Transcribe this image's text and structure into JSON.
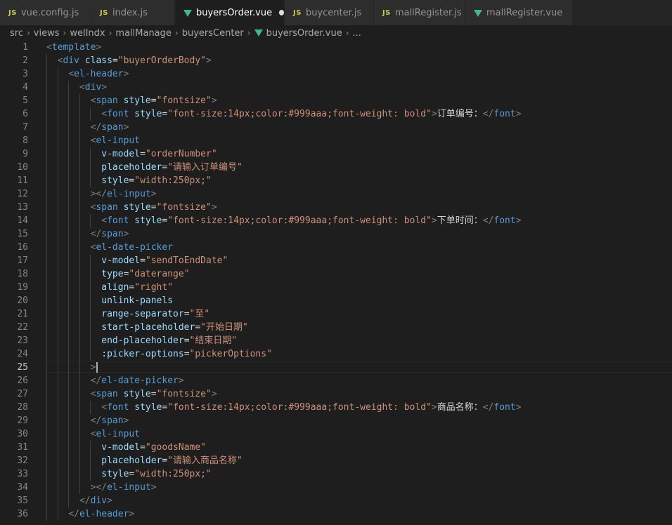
{
  "tabs": [
    {
      "icon": "js",
      "label": "vue.config.js",
      "active": false,
      "dirty": false
    },
    {
      "icon": "js",
      "label": "index.js",
      "active": false,
      "dirty": false
    },
    {
      "icon": "vue",
      "label": "buyersOrder.vue",
      "active": true,
      "dirty": true
    },
    {
      "icon": "js",
      "label": "buycenter.js",
      "active": false,
      "dirty": false
    },
    {
      "icon": "js",
      "label": "mallRegister.js",
      "active": false,
      "dirty": false
    },
    {
      "icon": "vue",
      "label": "mallRegister.vue",
      "active": false,
      "dirty": false
    }
  ],
  "breadcrumb": [
    "src",
    "views",
    "welIndx",
    "mallManage",
    "buyersCenter",
    "buyersOrder.vue",
    "..."
  ],
  "colors": {
    "tag": "#569cd6",
    "attr": "#9cdcfe",
    "string": "#ce9178",
    "text": "#d4d4d4",
    "punct": "#808080",
    "background": "#1e1e1e"
  },
  "current_line": 25,
  "lines": [
    {
      "n": "1",
      "code": "<template>"
    },
    {
      "n": "2",
      "code": "  <div class=\"buyerOrderBody\">"
    },
    {
      "n": "3",
      "code": "    <el-header>"
    },
    {
      "n": "4",
      "code": "      <div>"
    },
    {
      "n": "5",
      "code": "        <span style=\"fontsize\">"
    },
    {
      "n": "6",
      "code": "          <font style=\"font-size:14px;color:#999aaa;font-weight: bold\">订单编号：</font>"
    },
    {
      "n": "7",
      "code": "        </span>"
    },
    {
      "n": "8",
      "code": "        <el-input"
    },
    {
      "n": "9",
      "code": "          v-model=\"orderNumber\""
    },
    {
      "n": "10",
      "code": "          placeholder=\"请输入订单编号\""
    },
    {
      "n": "11",
      "code": "          style=\"width:250px;\""
    },
    {
      "n": "12",
      "code": "        ></el-input>"
    },
    {
      "n": "13",
      "code": "        <span style=\"fontsize\">"
    },
    {
      "n": "14",
      "code": "          <font style=\"font-size:14px;color:#999aaa;font-weight: bold\">下单时间：</font>"
    },
    {
      "n": "15",
      "code": "        </span>"
    },
    {
      "n": "16",
      "code": "        <el-date-picker"
    },
    {
      "n": "17",
      "code": "          v-model=\"sendToEndDate\""
    },
    {
      "n": "18",
      "code": "          type=\"daterange\""
    },
    {
      "n": "19",
      "code": "          align=\"right\""
    },
    {
      "n": "20",
      "code": "          unlink-panels"
    },
    {
      "n": "21",
      "code": "          range-separator=\"至\""
    },
    {
      "n": "22",
      "code": "          start-placeholder=\"开始日期\""
    },
    {
      "n": "23",
      "code": "          end-placeholder=\"结束日期\""
    },
    {
      "n": "24",
      "code": "          :picker-options=\"pickerOptions\""
    },
    {
      "n": "25",
      "code": "        >"
    },
    {
      "n": "26",
      "code": "        </el-date-picker>"
    },
    {
      "n": "27",
      "code": "        <span style=\"fontsize\">"
    },
    {
      "n": "28",
      "code": "          <font style=\"font-size:14px;color:#999aaa;font-weight: bold\">商品名称：</font>"
    },
    {
      "n": "29",
      "code": "        </span>"
    },
    {
      "n": "30",
      "code": "        <el-input"
    },
    {
      "n": "31",
      "code": "          v-model=\"goodsName\""
    },
    {
      "n": "32",
      "code": "          placeholder=\"请输入商品名称\""
    },
    {
      "n": "33",
      "code": "          style=\"width:250px;\""
    },
    {
      "n": "34",
      "code": "        ></el-input>"
    },
    {
      "n": "35",
      "code": "      </div>"
    },
    {
      "n": "36",
      "code": "    </el-header>"
    }
  ]
}
